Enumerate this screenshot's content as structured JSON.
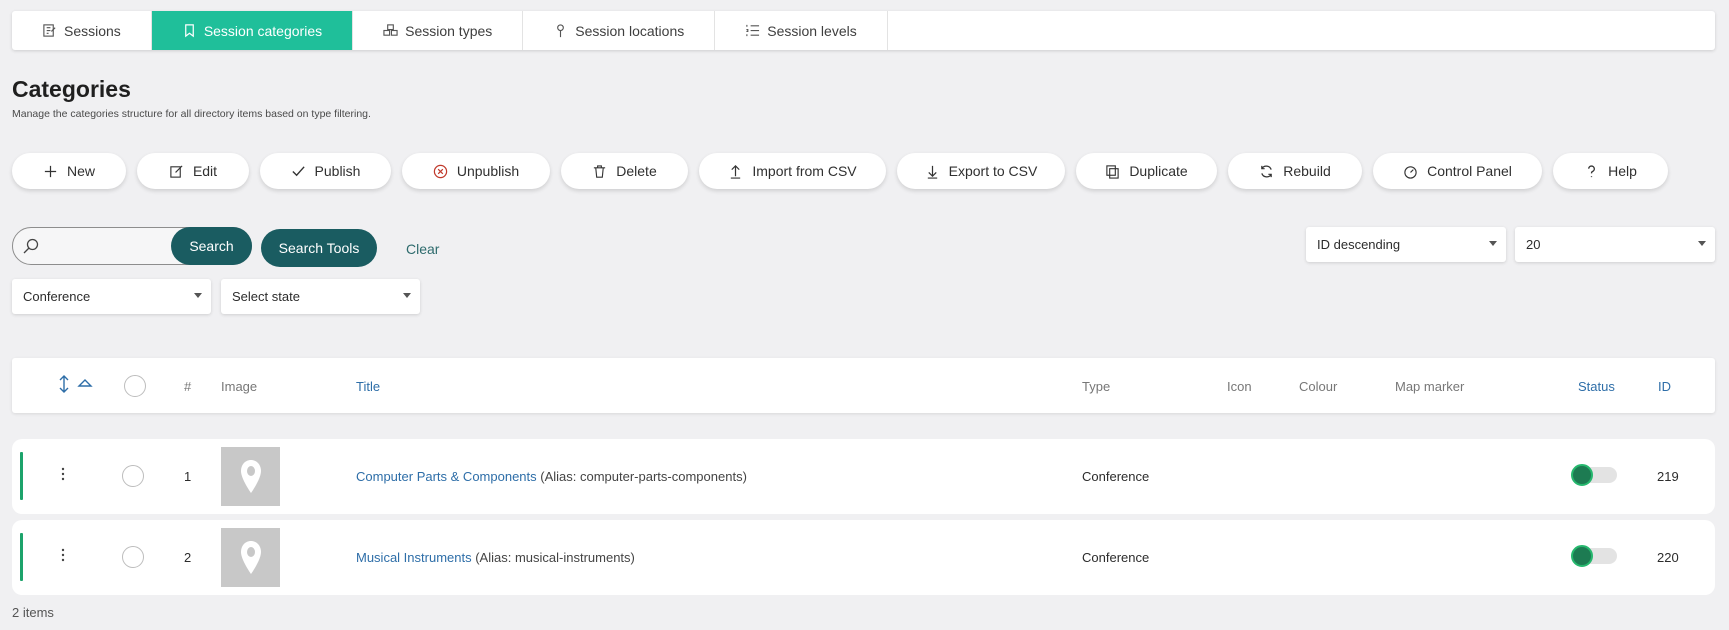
{
  "tabs": [
    {
      "label": "Sessions",
      "icon": "sessions-icon",
      "active": false
    },
    {
      "label": "Session categories",
      "icon": "categories-icon",
      "active": true
    },
    {
      "label": "Session types",
      "icon": "types-icon",
      "active": false
    },
    {
      "label": "Session locations",
      "icon": "location-pin-icon",
      "active": false
    },
    {
      "label": "Session levels",
      "icon": "list-levels-icon",
      "active": false
    }
  ],
  "header": {
    "title": "Categories",
    "description": "Manage the categories structure for all directory items based on type filtering."
  },
  "toolbar": {
    "new": "New",
    "edit": "Edit",
    "publish": "Publish",
    "unpublish": "Unpublish",
    "delete": "Delete",
    "import": "Import from CSV",
    "export": "Export to CSV",
    "duplicate": "Duplicate",
    "rebuild": "Rebuild",
    "control_panel": "Control Panel",
    "help": "Help"
  },
  "search": {
    "value": "",
    "placeholder": "",
    "button": "Search",
    "tools": "Search Tools",
    "clear": "Clear"
  },
  "filters": {
    "ordering": "ID descending",
    "limit": "20",
    "type": "Conference",
    "state": "Select state"
  },
  "table": {
    "columns": {
      "number": "#",
      "image": "Image",
      "title": "Title",
      "type": "Type",
      "icon": "Icon",
      "colour": "Colour",
      "map_marker": "Map marker",
      "status": "Status",
      "id": "ID"
    },
    "rows": [
      {
        "num": "1",
        "title": "Computer Parts & Components",
        "alias": "(Alias: computer-parts-components)",
        "type": "Conference",
        "published": true,
        "id": "219"
      },
      {
        "num": "2",
        "title": "Musical Instruments",
        "alias": "(Alias: musical-instruments)",
        "type": "Conference",
        "published": true,
        "id": "220"
      }
    ],
    "count": "2 items"
  },
  "colors": {
    "accent_tab": "#1fbf9a",
    "primary_button": "#1a5c61",
    "link": "#2e6ea8",
    "status_green": "#1d7b52"
  }
}
